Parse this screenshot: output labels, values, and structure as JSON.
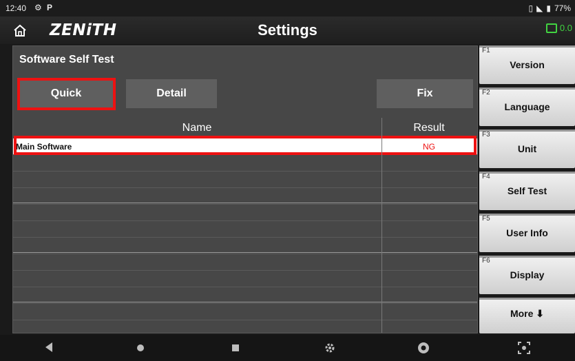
{
  "status_bar": {
    "time": "12:40",
    "battery_percent": "77%",
    "icons": [
      "settings-gear-icon",
      "p-icon",
      "vibrate-icon",
      "wifi-icon",
      "battery-icon"
    ]
  },
  "header": {
    "logo": "ZENiTH",
    "title": "Settings",
    "battery_value": "0.0",
    "accent": "#41d341"
  },
  "panel": {
    "title": "Software Self Test",
    "buttons": {
      "quick": "Quick",
      "detail": "Detail",
      "fix": "Fix"
    },
    "columns": {
      "name": "Name",
      "result": "Result"
    },
    "rows": [
      {
        "name": "Main Software",
        "result": "NG"
      }
    ],
    "highlight_color": "#ee1111"
  },
  "function_keys": [
    {
      "key": "F1",
      "label": "Version"
    },
    {
      "key": "F2",
      "label": "Language"
    },
    {
      "key": "F3",
      "label": "Unit"
    },
    {
      "key": "F4",
      "label": "Self Test"
    },
    {
      "key": "F5",
      "label": "User Info"
    },
    {
      "key": "F6",
      "label": "Display"
    },
    {
      "key": "",
      "label": "More ⬇"
    }
  ],
  "nav_bar": {
    "items": [
      "back-icon",
      "home-dot-icon",
      "recents-icon",
      "settings-icon",
      "chrome-icon",
      "screenshot-icon"
    ]
  }
}
